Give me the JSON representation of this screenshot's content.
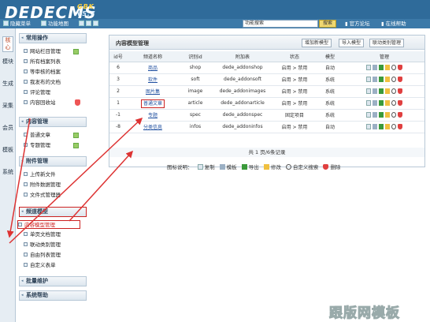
{
  "header": {
    "logo": "DEDECMS",
    "version": "v5.7",
    "edition": "GBK",
    "search_placeholder": "功能搜索",
    "search_button": "搜索",
    "links": [
      "官方论坛",
      "在线帮助"
    ],
    "toolbar": [
      "隐藏菜单",
      "功能地图"
    ]
  },
  "left_tabs": [
    "核心",
    "模块",
    "生成",
    "采集",
    "会员",
    "模板",
    "系统"
  ],
  "menu": {
    "sections": [
      {
        "title": "常用操作",
        "items": [
          "网站栏目管理",
          "所有档案列表",
          "等审核的档案",
          "我发布的文档",
          "评论管理",
          "内容回收站"
        ]
      },
      {
        "title": "内容管理",
        "items": [
          "普通文章",
          "专题管理"
        ]
      },
      {
        "title": "附件管理",
        "items": [
          "上传新文件",
          "附件数据管理",
          "文件式管理器"
        ]
      },
      {
        "title": "频道模型",
        "items": [
          "内容模型管理",
          "单页文档管理",
          "联动类别管理",
          "自由列表管理",
          "自定义表单"
        ]
      },
      {
        "title": "批量维护",
        "items": []
      },
      {
        "title": "系统帮助",
        "items": []
      }
    ]
  },
  "content": {
    "title": "内容模型管理",
    "buttons": [
      "增加新模型",
      "导入模型",
      "联动类别管理"
    ],
    "columns": [
      "id号",
      "频道名称",
      "识别id",
      "附加表",
      "状态",
      "模型",
      "管理"
    ],
    "rows": [
      [
        "6",
        "商品",
        "shop",
        "dede_addonshop",
        "启用 > 禁用",
        "自动"
      ],
      [
        "3",
        "软件",
        "soft",
        "dede_addonsoft",
        "启用 > 禁用",
        "系统"
      ],
      [
        "2",
        "图片集",
        "image",
        "dede_addonimages",
        "启用 > 禁用",
        "系统"
      ],
      [
        "1",
        "普通文章",
        "article",
        "dede_addonarticle",
        "启用 > 禁用",
        "系统"
      ],
      [
        "-1",
        "专题",
        "spec",
        "dede_addonspec",
        "固定项目",
        "系统"
      ],
      [
        "-8",
        "分类信息",
        "infos",
        "dede_addoninfos",
        "启用 > 禁用",
        "自动"
      ]
    ],
    "pager": "共 1 页/6条记录",
    "legend_label": "图标说明：",
    "legend": [
      "复制",
      "模板",
      "导出",
      "修改",
      "自定义搜索",
      "删除"
    ]
  },
  "watermark": "跟版网模板",
  "colors": {
    "header": "#2f6b9a",
    "highlight": "#cc2222",
    "link": "#2050a0"
  }
}
